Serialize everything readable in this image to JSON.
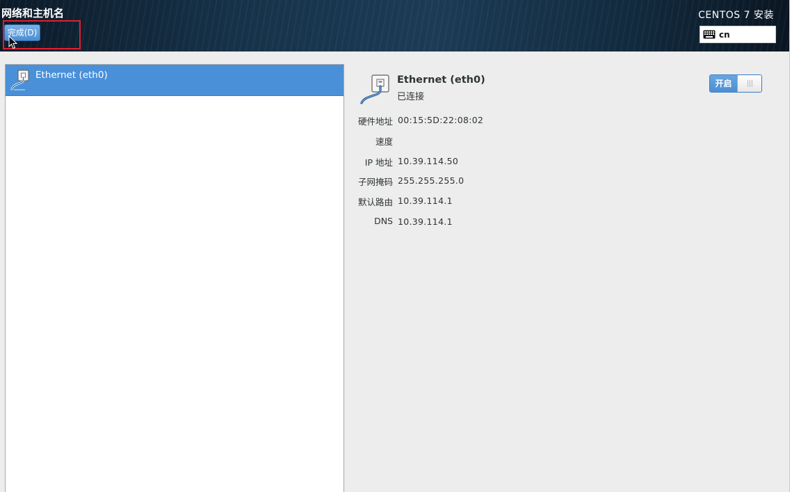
{
  "header": {
    "title": "网络和主机名",
    "done_label": "完成(D)",
    "install_title": "CENTOS 7 安装",
    "keyboard_layout": "cn"
  },
  "device_list": {
    "items": [
      {
        "label": "Ethernet (eth0)",
        "icon": "ethernet-cable-icon",
        "selected": true
      }
    ]
  },
  "device_detail": {
    "name": "Ethernet (eth0)",
    "status": "已连接",
    "toggle_label": "开启",
    "toggle_on": true,
    "properties": {
      "hardware_address": {
        "label": "硬件地址",
        "value": "00:15:5D:22:08:02"
      },
      "speed": {
        "label": "速度",
        "value": ""
      },
      "ip_address": {
        "label": "IP 地址",
        "value": "10.39.114.50"
      },
      "subnet_mask": {
        "label": "子网掩码",
        "value": "255.255.255.0"
      },
      "default_route": {
        "label": "默认路由",
        "value": "10.39.114.1"
      },
      "dns": {
        "label": "DNS",
        "value": "10.39.114.1"
      }
    }
  },
  "colors": {
    "accent": "#4a90d9",
    "highlight_box": "#e02030",
    "header_dark": "#163249"
  }
}
